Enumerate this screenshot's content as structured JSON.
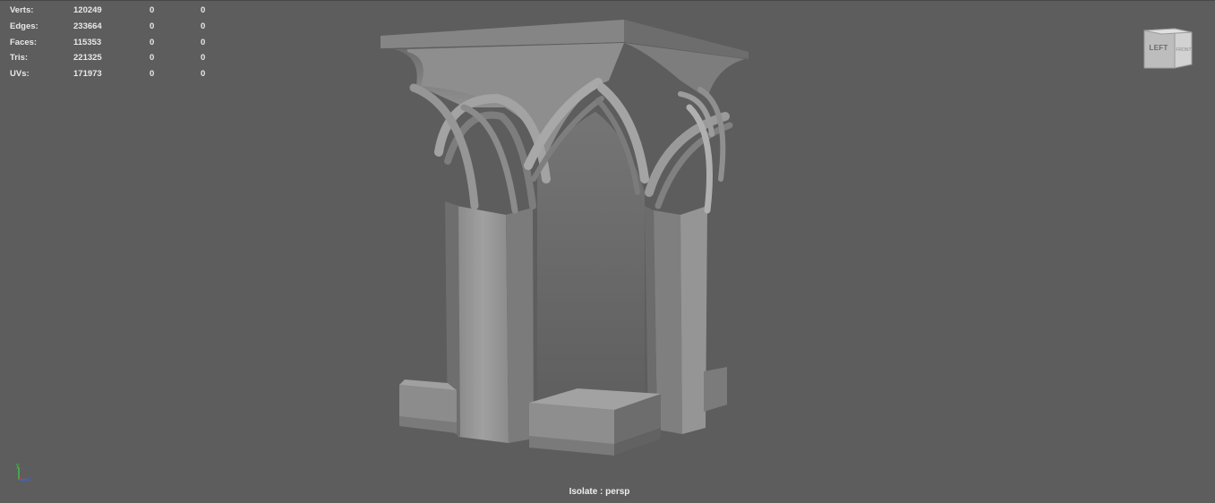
{
  "hud": {
    "rows": [
      {
        "label": "Verts:",
        "total": "120249",
        "selected": "0",
        "component": "0"
      },
      {
        "label": "Edges:",
        "total": "233664",
        "selected": "0",
        "component": "0"
      },
      {
        "label": "Faces:",
        "total": "115353",
        "selected": "0",
        "component": "0"
      },
      {
        "label": "Tris:",
        "total": "221325",
        "selected": "0",
        "component": "0"
      },
      {
        "label": "UVs:",
        "total": "171973",
        "selected": "0",
        "component": "0"
      }
    ]
  },
  "viewcube": {
    "face_label": "LEFT",
    "side_label": "FRONT"
  },
  "axis": {
    "y_label": "y",
    "z_label": "z",
    "x_color": "#e03030",
    "y_color": "#3fc24a",
    "z_color": "#3a66e0"
  },
  "status": {
    "text": "Isolate : persp"
  },
  "colors": {
    "background": "#5d5d5d",
    "model_light": "#9a9a9a",
    "model_mid": "#858585",
    "model_dark": "#6e6e6e"
  }
}
